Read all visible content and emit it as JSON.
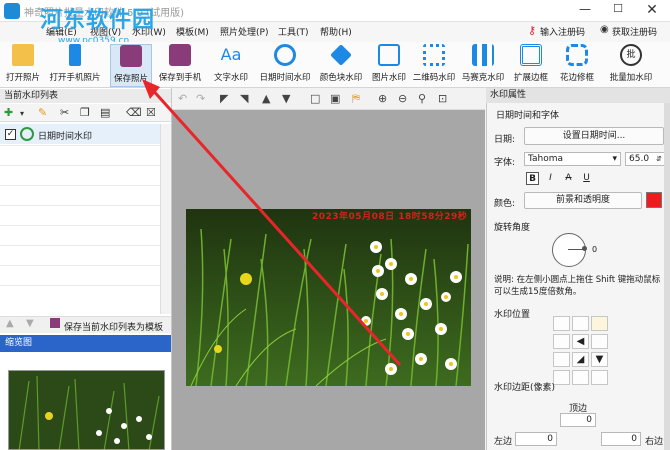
{
  "window": {
    "title": "神奇照片批量水印软件 5.0 (试用版)",
    "minimize": "—",
    "maximize": "☐",
    "close": "✕"
  },
  "overlay": {
    "site_logo": "河东软件园",
    "site_url": "www.pc0359.cn"
  },
  "menu": {
    "items": [
      "编辑(E)",
      "视图(V)",
      "水印(W)",
      "模板(M)",
      "照片处理(P)",
      "工具(T)",
      "帮助(H)"
    ],
    "register": "输入注册码",
    "get_code": "获取注册码"
  },
  "toolbar": {
    "items": [
      {
        "label": "打开照片",
        "icon": "folder-open-icon",
        "color": "#e8a317"
      },
      {
        "label": "打开手机照片",
        "icon": "phone-icon",
        "color": "#1e88e5"
      },
      {
        "label": "保存照片",
        "icon": "save-disk-icon",
        "color": "#8a3c7a"
      },
      {
        "label": "保存到手机",
        "icon": "save-to-phone-icon",
        "color": "#8a3c7a"
      },
      {
        "label": "文字水印",
        "icon": "text-aa-icon",
        "color": "#1e88e5"
      },
      {
        "label": "日期时间水印",
        "icon": "clock-icon",
        "color": "#1e88e5"
      },
      {
        "label": "颜色块水印",
        "icon": "paint-bucket-icon",
        "color": "#1e88e5"
      },
      {
        "label": "图片水印",
        "icon": "picture-icon",
        "color": "#1e88e5"
      },
      {
        "label": "二维码水印",
        "icon": "qr-code-icon",
        "color": "#1e88e5"
      },
      {
        "label": "马赛克水印",
        "icon": "mosaic-icon",
        "color": "#1e88e5"
      },
      {
        "label": "扩展边框",
        "icon": "expand-border-icon",
        "color": "#1e88e5"
      },
      {
        "label": "花边修框",
        "icon": "lace-frame-icon",
        "color": "#1e88e5"
      },
      {
        "label": "批量加水印",
        "icon": "batch-icon",
        "color": "#333333"
      }
    ]
  },
  "left_panel": {
    "header": "当前水印列表",
    "watermark_items": [
      {
        "label": "日期时间水印",
        "checked": true
      }
    ],
    "save_template": "保存当前水印列表为模板",
    "thumbnail_header": "缩览图"
  },
  "photo": {
    "timestamp_overlay": "2023年05月08日 18时58分29秒"
  },
  "right_panel": {
    "header": "水印属性",
    "datetime_font_title": "日期时间和字体",
    "date_label": "日期:",
    "date_button": "设置日期时间...",
    "font_label": "字体:",
    "font_name": "Tahoma",
    "font_size": "65.0",
    "format_buttons": [
      "B",
      "I",
      "A",
      "U"
    ],
    "color_label": "颜色:",
    "color_button": "前景和透明度",
    "color_value": "#ee1c1c",
    "rotation_title": "旋转角度",
    "angle_value": "0",
    "angle_note": "说明: 在左侧小圆点上拖住 Shift 键拖动鼠标可以生成15度倍数角。",
    "position_title": "水印位置",
    "margin_title": "水印边距(像素)",
    "margin_top_label": "顶边",
    "margin_left_label": "左边",
    "margin_right_label": "右边",
    "margin_top": "0",
    "margin_left": "0",
    "margin_right": "0"
  }
}
